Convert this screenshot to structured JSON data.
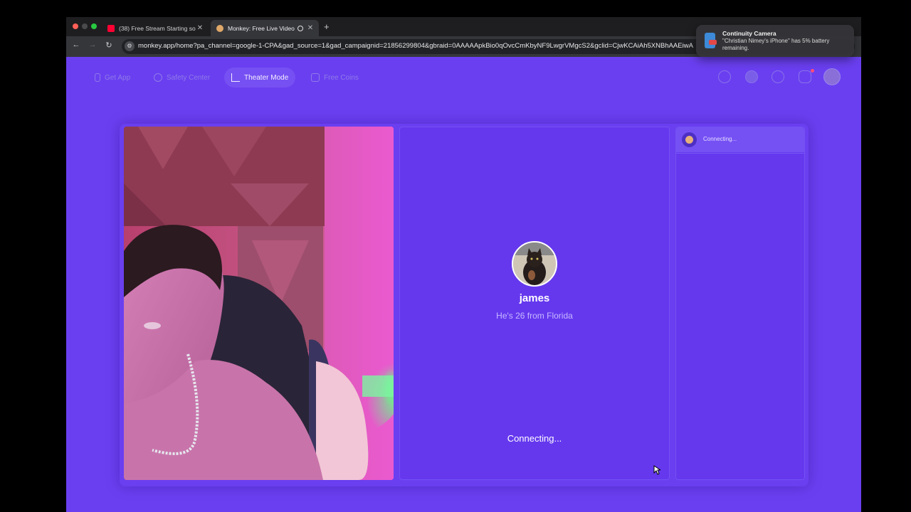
{
  "browser": {
    "tabs": [
      {
        "title": "(38) Free Stream Starting so",
        "favicon": "youtube-icon",
        "active": false
      },
      {
        "title": "Monkey: Free Live Video",
        "favicon": "monkey-icon",
        "active": true
      }
    ],
    "url": "monkey.app/home?pa_channel=google-1-CPA&gad_source=1&gad_campaignid=21856299804&gbraid=0AAAAApkBio0qOvcCmKbyNF9LwgrVMgcS2&gclid=CjwKCAiAh5XNBhAAEiwA"
  },
  "nav": {
    "items": [
      {
        "label": "Get App",
        "icon": "phone-icon"
      },
      {
        "label": "Safety Center",
        "icon": "shield-icon"
      },
      {
        "label": "Theater Mode",
        "icon": "expand-icon"
      },
      {
        "label": "Free Coins",
        "icon": "coins-icon"
      }
    ],
    "right_icons": [
      "search-icon",
      "coin-icon",
      "clock-icon",
      "chat-icon",
      "profile-avatar"
    ]
  },
  "match": {
    "name": "james",
    "info": "He's 26 from Florida",
    "status": "Connecting..."
  },
  "chat": {
    "status": "Connecting..."
  },
  "notification": {
    "title": "Continuity Camera",
    "body": "\"Christian Nimey's iPhone\" has 5% battery remaining."
  },
  "colors": {
    "page_bg": "#6a3ff0",
    "panel_bg": "#6538ee",
    "active_nav": "#7650f2"
  }
}
